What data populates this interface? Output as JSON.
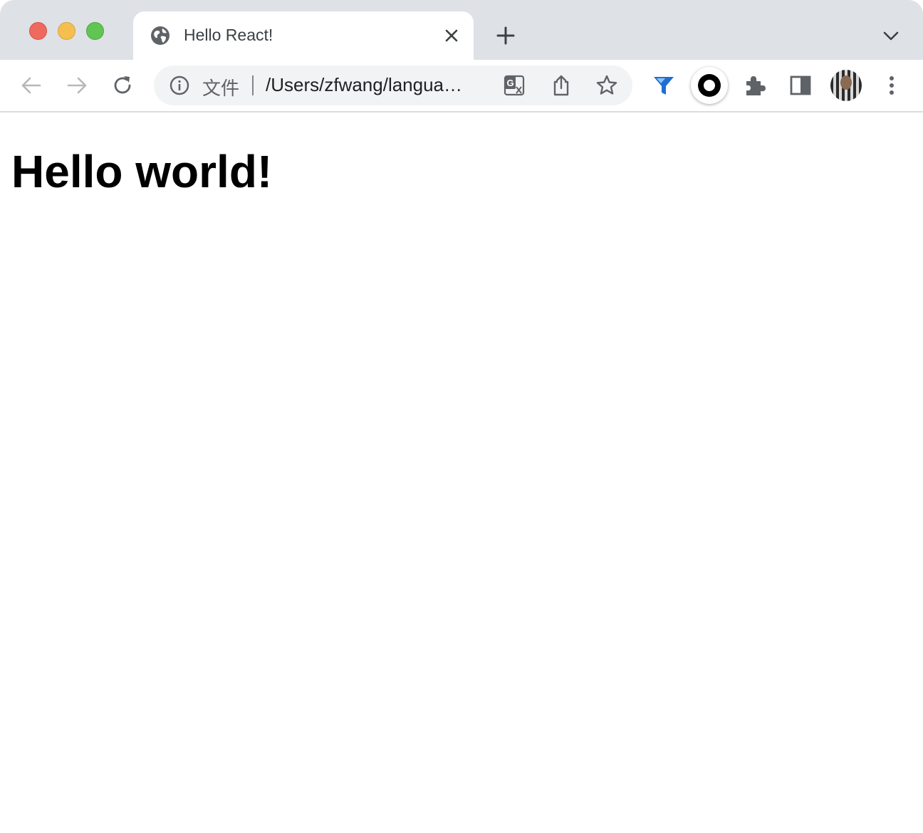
{
  "browser": {
    "tab": {
      "title": "Hello React!",
      "favicon": "globe-icon"
    },
    "toolbar": {
      "back": "arrow-left-icon",
      "forward": "arrow-right-icon",
      "reload": "reload-icon",
      "omnibox": {
        "scheme_label": "文件",
        "url": "/Users/zfwang/langua…",
        "actions": [
          "translate-icon",
          "share-icon",
          "bookmark-star-icon"
        ]
      },
      "extensions": [
        "funnel-extension-icon",
        "ring-extension-icon",
        "puzzle-extensions-icon",
        "side-panel-icon"
      ],
      "menu": "kebab-menu-icon"
    },
    "colors": {
      "tabstrip": "#dee1e6",
      "traffic_close": "#ee6a5e",
      "traffic_minimize": "#f5bf4f",
      "traffic_maximize": "#61c554"
    }
  },
  "page": {
    "heading": "Hello world!"
  }
}
